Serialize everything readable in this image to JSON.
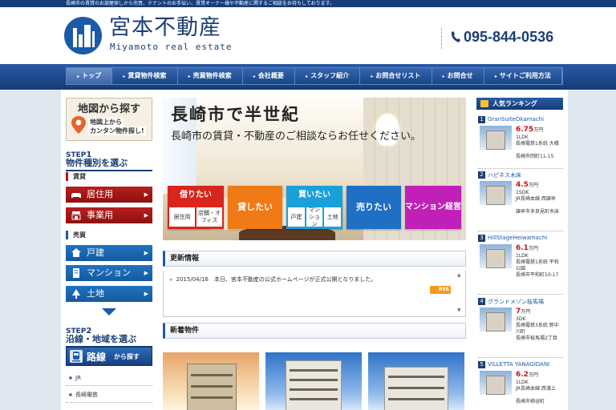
{
  "topbar": {
    "text": "長崎市の賃貸のお部屋探しから売買、テナントのお手伝い、賃貸オーナー様や不動産に関するご相談をお待ちしております。"
  },
  "header": {
    "title": "宮本不動産",
    "subtitle": "Miyamoto real estate",
    "phone": "095-844-0536"
  },
  "nav": [
    "トップ",
    "賃貸物件検索",
    "売買物件検索",
    "会社概要",
    "スタッフ紹介",
    "お問合せリスト",
    "お問合せ",
    "サイトご利用方法"
  ],
  "map_banner": {
    "title": "地図から探す",
    "line1": "地図上から",
    "line2": "カンタン物件探し!"
  },
  "step1": {
    "label": "STEP",
    "num": "1",
    "sub": "物件種別を選ぶ"
  },
  "rent": {
    "label": "賃貸",
    "items": [
      "居住用",
      "事業用"
    ]
  },
  "sale": {
    "label": "売買",
    "items": [
      "戸建",
      "マンション",
      "土地"
    ]
  },
  "step2": {
    "label": "STEP",
    "num": "2",
    "sub": "沿線・地域を選ぶ"
  },
  "route": {
    "title": "路線",
    "suffix": "から探す",
    "items": [
      "JR",
      "長崎電鉄"
    ]
  },
  "hero": {
    "headline": "長崎市で半世紀",
    "tagline": "長崎市の賃貸・不動産のご相談ならお任せください。",
    "buttons": [
      {
        "label": "借りたい",
        "color": "#d8261c",
        "subs": [
          "居住用",
          "店舗・オフィス"
        ]
      },
      {
        "label": "貸したい",
        "color": "#f07a16"
      },
      {
        "label": "買いたい",
        "color": "#1aa0d8",
        "subs": [
          "戸建",
          "マンション",
          "土地"
        ]
      },
      {
        "label": "売りたい",
        "color": "#1f6fc4"
      },
      {
        "label": "マンション経営",
        "color": "#c020b8"
      }
    ]
  },
  "news": {
    "heading": "更新情報",
    "items": [
      "2015/04/16　本日、宮本不動産の公式ホームページが正式公開となりました。"
    ],
    "rss": "RSS"
  },
  "new_listings": {
    "heading": "新着物件"
  },
  "ranking": {
    "heading": "人気ランキング",
    "items": [
      {
        "rank": "1",
        "name": "GranSuiteOkamachi",
        "price": "6.75",
        "unit": "万円",
        "lines": [
          "1LDK",
          "長崎電鉄1系統 大橋",
          "長崎市岡町11-15"
        ]
      },
      {
        "rank": "2",
        "name": "ハピネス木床",
        "price": "4.5",
        "unit": "万円",
        "lines": [
          "1SDK",
          "JR長崎本線 西諫早",
          "諫早市多良見町木床"
        ]
      },
      {
        "rank": "3",
        "name": "HillStageHeiwamachi",
        "price": "6.1",
        "unit": "万円",
        "lines": [
          "1LDK",
          "長崎電鉄1系統 平和公園",
          "長崎市平和町10-17"
        ]
      },
      {
        "rank": "4",
        "name": "グランドメゾン桜馬場",
        "price": "7",
        "unit": "万円",
        "lines": [
          "3DK",
          "長崎電鉄3系統 新中川町",
          "長崎市桜馬場2丁目"
        ]
      },
      {
        "rank": "5",
        "name": "VILLETTA YANAGIDANI",
        "price": "6.2",
        "unit": "万円",
        "lines": [
          "1LDK",
          "JR長崎本線 西浦上",
          "長崎市柳谷町"
        ]
      }
    ]
  },
  "colors": {
    "brand": "#1b3f72",
    "accent": "#1a5aa8",
    "rent": "#b81e1e",
    "price": "#c0161a"
  }
}
